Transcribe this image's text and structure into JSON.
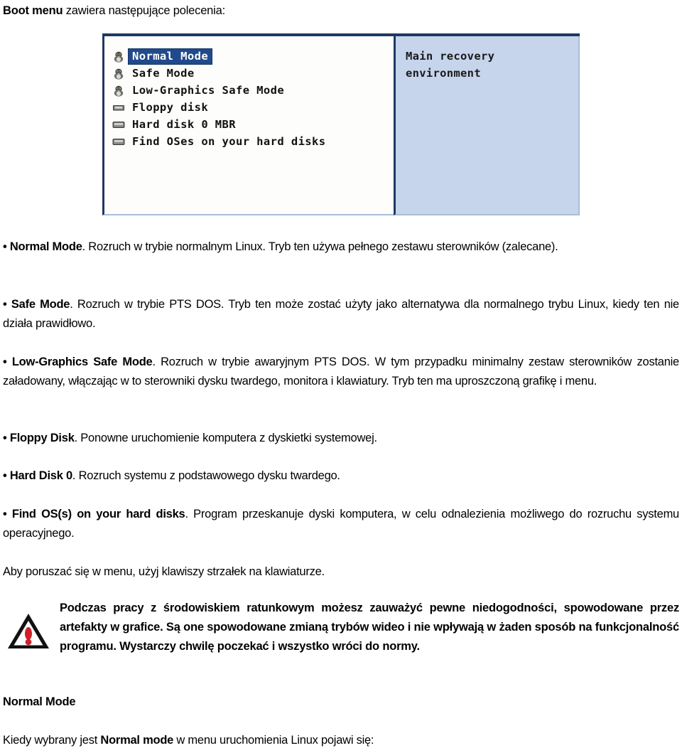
{
  "intro": {
    "bold_lead": "Boot menu",
    "rest": " zawiera następujące polecenia:"
  },
  "boot_menu_figure": {
    "menu_items": [
      {
        "icon": "penguin-icon",
        "label": "Normal Mode",
        "selected": true
      },
      {
        "icon": "penguin-icon",
        "label": "Safe Mode",
        "selected": false
      },
      {
        "icon": "penguin-icon",
        "label": "Low-Graphics Safe Mode",
        "selected": false
      },
      {
        "icon": "floppy-disk-icon",
        "label": "Floppy disk",
        "selected": false
      },
      {
        "icon": "hard-disk-icon",
        "label": "Hard disk 0 MBR",
        "selected": false
      },
      {
        "icon": "hard-disk-icon",
        "label": "Find OSes on your hard disks",
        "selected": false
      }
    ],
    "info_pane": {
      "line1": "Main recovery",
      "line2": "environment"
    },
    "colors": {
      "selection": "#1f4a8c",
      "info_background": "#c6d4ed",
      "border": "#1f3864"
    }
  },
  "descriptions": [
    {
      "term": "• Normal Mode",
      "text": ". Rozruch w trybie normalnym Linux. Tryb ten używa pełnego zestawu sterowników (zalecane)."
    },
    {
      "term": "• Safe Mode",
      "text": ". Rozruch w trybie PTS DOS. Tryb ten może zostać użyty jako alternatywa dla normalnego trybu Linux, kiedy ten nie działa prawidłowo."
    },
    {
      "term": "• Low-Graphics Safe Mode",
      "text": ". Rozruch w trybie awaryjnym PTS DOS. W tym przypadku minimalny zestaw sterowników zostanie załadowany, włączając w to sterowniki dysku twardego, monitora i klawiatury. Tryb ten ma uproszczoną grafikę i menu."
    },
    {
      "term": "• Floppy Disk",
      "text": ". Ponowne uruchomienie komputera z dyskietki systemowej."
    },
    {
      "term": "• Hard Disk 0",
      "text": ". Rozruch systemu z podstawowego dysku twardego."
    },
    {
      "term": "• Find OS(s) on your hard disks",
      "text": ". Program przeskanuje dyski komputera, w celu odnalezienia możliwego do rozruchu systemu operacyjnego."
    }
  ],
  "navigation_note": "Aby poruszać się w menu, użyj klawiszy strzałek na klawiaturze.",
  "warning": {
    "icon": "warning-triangle-icon",
    "text": "Podczas pracy z środowiskiem ratunkowym możesz zauważyć pewne niedogodności, spowodowane przez artefakty w grafice. Są one spowodowane zmianą trybów wideo i nie wpływają w żaden sposób na funkcjonalność programu. Wystarczy chwilę poczekać i wszystko wróci do normy.",
    "icon_color": "#cc2229"
  },
  "section": {
    "title": "Normal Mode",
    "closing_pre": "Kiedy wybrany jest ",
    "closing_bold": "Normal mode",
    "closing_post": " w menu uruchomienia Linux pojawi się:"
  }
}
